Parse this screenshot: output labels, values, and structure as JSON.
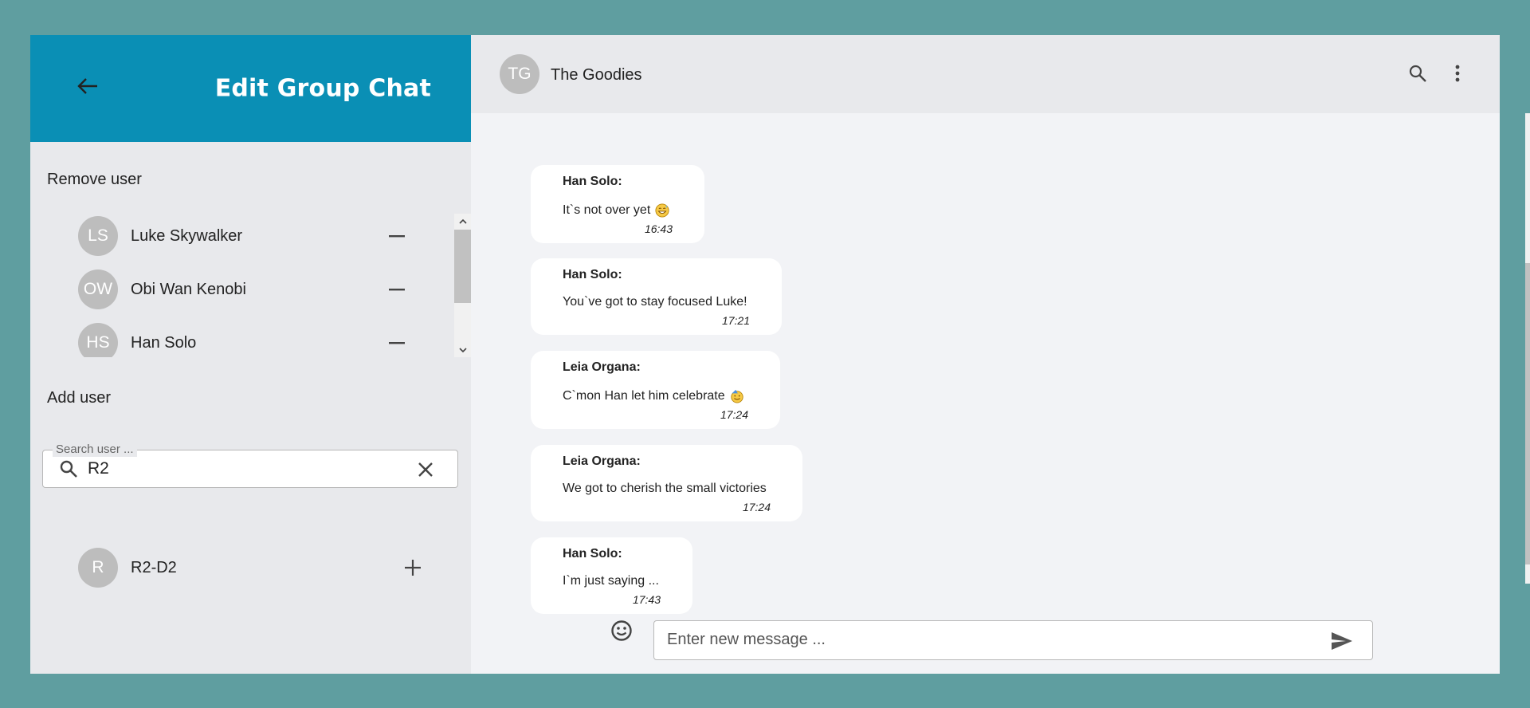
{
  "sidebar": {
    "title": "Edit Group Chat",
    "remove_label": "Remove user",
    "add_label": "Add user",
    "members": [
      {
        "initials": "LS",
        "name": "Luke Skywalker"
      },
      {
        "initials": "OW",
        "name": "Obi Wan Kenobi"
      },
      {
        "initials": "HS",
        "name": "Han Solo"
      }
    ],
    "search": {
      "legend": "Search user ...",
      "value": "R2"
    },
    "results": [
      {
        "initials": "R",
        "name": "R2-D2"
      }
    ]
  },
  "chat": {
    "avatar_initials": "TG",
    "title": "The Goodies",
    "messages": [
      {
        "sender": "Han Solo:",
        "text": "It`s not over yet",
        "emoji": "grinning-sweat-emoji",
        "time": "16:43"
      },
      {
        "sender": "Han Solo:",
        "text": "You`ve got to stay focused Luke!",
        "time": "17:21"
      },
      {
        "sender": "Leia Organa:",
        "text": "C`mon Han let him celebrate",
        "emoji": "partying-face-emoji",
        "time": "17:24"
      },
      {
        "sender": "Leia Organa:",
        "text": "We got to cherish the small victories",
        "time": "17:24"
      },
      {
        "sender": "Han Solo:",
        "text": "I`m just saying ...",
        "time": "17:43"
      }
    ],
    "composer": {
      "placeholder": "Enter new message ..."
    }
  },
  "colors": {
    "background": "#5f9ea0",
    "header_accent": "#0a8fb5",
    "panel": "#e8e9ec",
    "chat_bg": "#f2f3f6",
    "avatar": "#bdbdbd"
  }
}
